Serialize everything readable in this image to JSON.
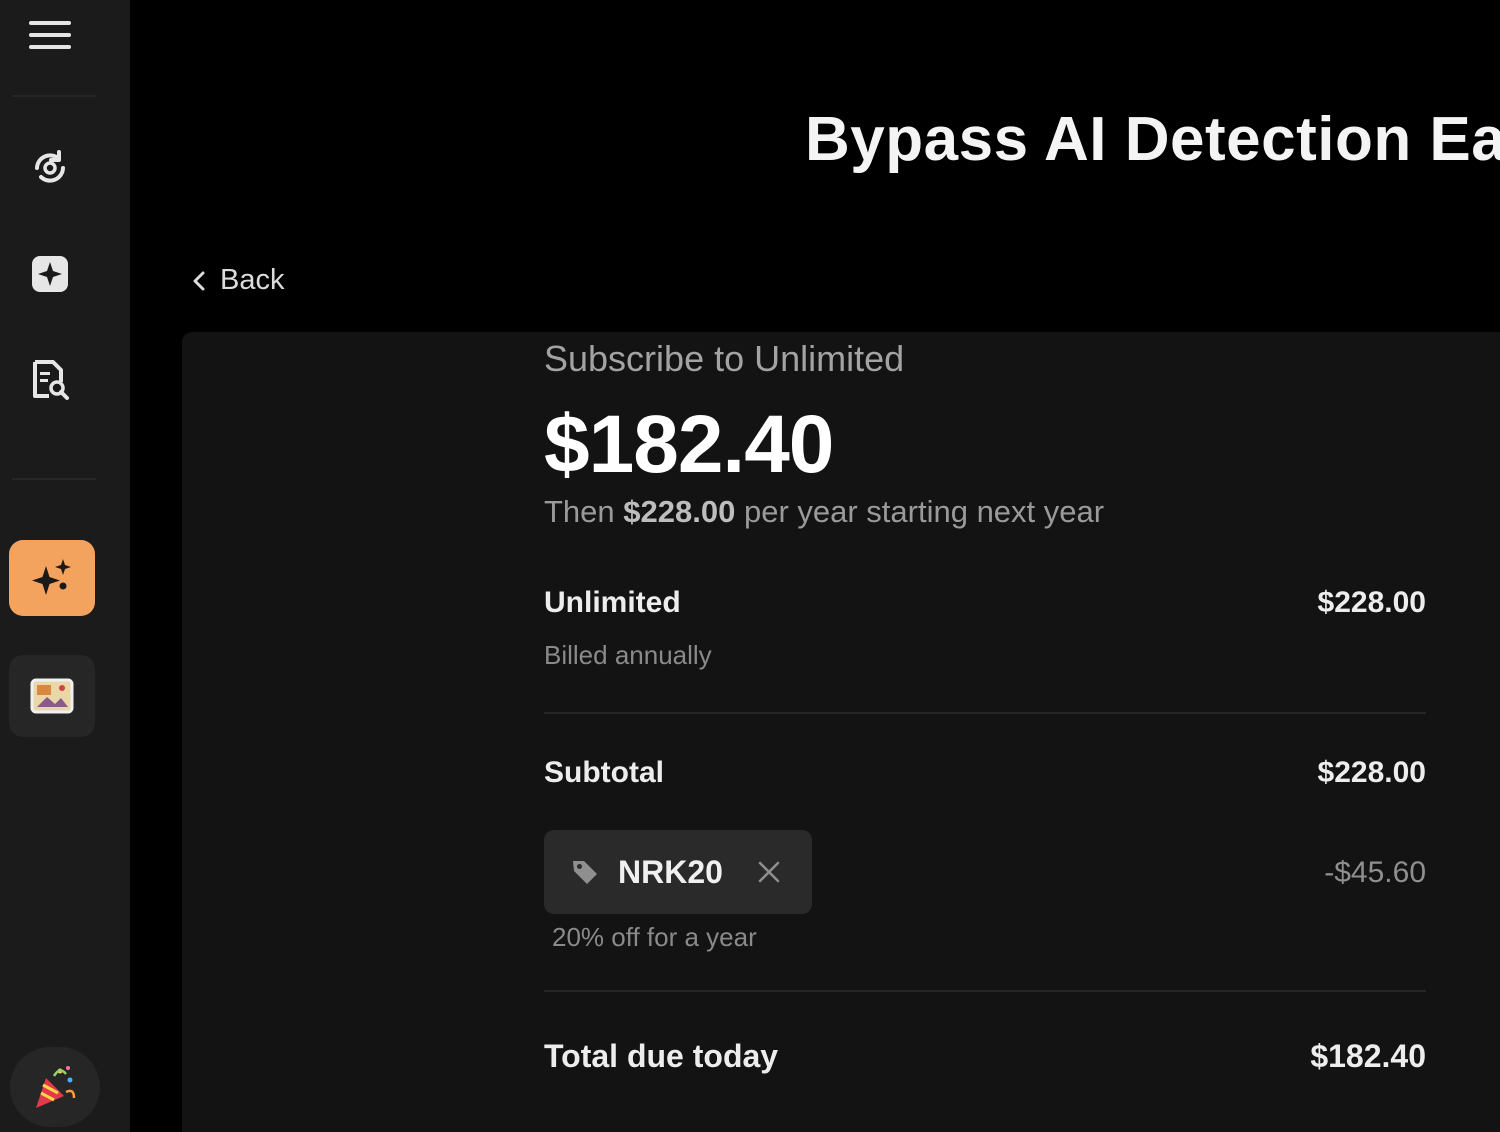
{
  "sidebar": {
    "icons": [
      "menu-icon",
      "refresh-scan-icon",
      "sparkle-square-icon",
      "document-search-icon",
      "sparkles-icon",
      "image-icon",
      "party-popper-icon"
    ],
    "accent_color": "#f3a35e"
  },
  "header": {
    "title": "Bypass AI Detection Ea",
    "back_label": "Back"
  },
  "checkout": {
    "subscribe_label": "Subscribe to Unlimited",
    "price_today": "$182.40",
    "then_prefix": "Then ",
    "then_amount": "$228.00",
    "then_suffix": " per year starting next year",
    "plan_name": "Unlimited",
    "plan_price": "$228.00",
    "billing_note": "Billed annually",
    "subtotal_label": "Subtotal",
    "subtotal_amount": "$228.00",
    "promo_code": "NRK20",
    "promo_note": "20% off for a year",
    "discount_amount": "-$45.60",
    "total_label": "Total due today",
    "total_amount": "$182.40"
  }
}
